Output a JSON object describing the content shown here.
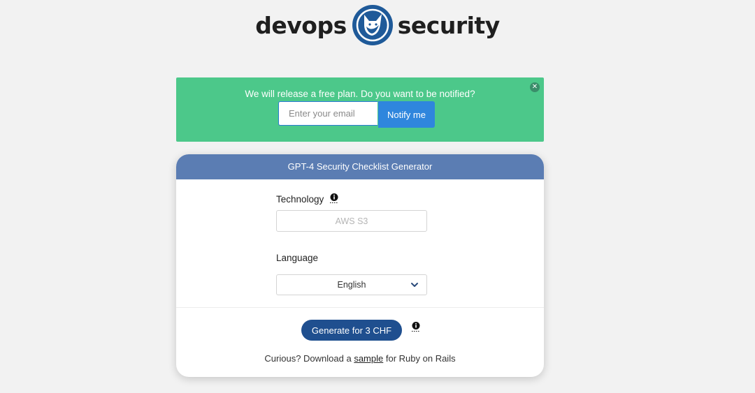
{
  "logo": {
    "left_word": "devops",
    "right_word": "security",
    "mark_icon": "fox-circle-icon",
    "brand_color": "#1f5a99"
  },
  "banner": {
    "message": "We will release a free plan. Do you want to be notified?",
    "email_placeholder": "Enter your email",
    "email_value": "",
    "button_label": "Notify me",
    "close_icon": "close-icon",
    "color": "#4cc88a"
  },
  "card": {
    "title": "GPT-4 Security Checklist Generator",
    "header_color": "#5b7db3",
    "technology": {
      "label": "Technology",
      "info_icon": "info-icon",
      "placeholder": "AWS S3",
      "value": ""
    },
    "language": {
      "label": "Language",
      "selected": "English",
      "dropdown_icon": "chevron-down-icon"
    },
    "generate": {
      "label": "Generate for 3 CHF",
      "info_icon": "info-icon",
      "color": "#1f4f8f"
    },
    "footer": {
      "prefix": "Curious? Download a",
      "link": "sample",
      "suffix": "for Ruby on Rails"
    }
  }
}
